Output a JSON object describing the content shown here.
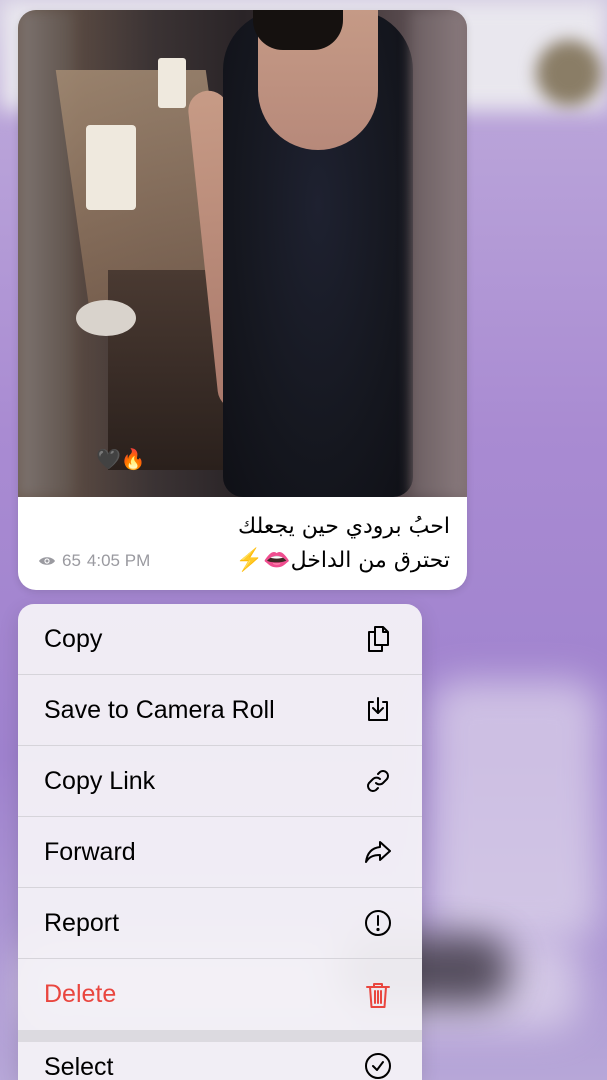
{
  "message": {
    "photo_emoji": "🖤🔥",
    "caption_line1": "احبُ برودي حين يجعلك",
    "caption_line2": "تحترق من الداخل👄⚡️",
    "views": "65",
    "time": "4:05 PM"
  },
  "menu": {
    "items": [
      {
        "label": "Copy",
        "icon": "copy-icon"
      },
      {
        "label": "Save to Camera Roll",
        "icon": "save-download-icon"
      },
      {
        "label": "Copy Link",
        "icon": "link-icon"
      },
      {
        "label": "Forward",
        "icon": "forward-arrow-icon"
      },
      {
        "label": "Report",
        "icon": "exclamation-circle-icon"
      },
      {
        "label": "Delete",
        "icon": "trash-icon"
      },
      {
        "label": "Select",
        "icon": "check-circle-icon"
      }
    ]
  },
  "colors": {
    "destructive": "#e9463f",
    "meta_gray": "#9a9aa0",
    "menu_bg": "#f4f2f7"
  }
}
